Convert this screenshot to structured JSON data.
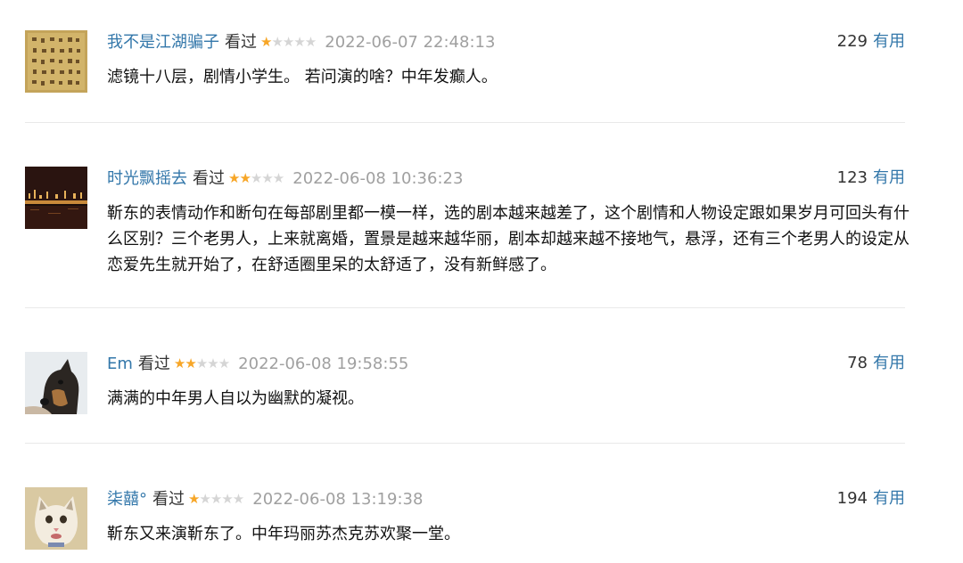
{
  "comments": [
    {
      "username": "我不是江湖骗子",
      "watched": "看过",
      "rating": 1,
      "date": "2022-06-07 22:48:13",
      "votes": "229",
      "useful": "有用",
      "text": "滤镜十八层，剧情小学生。 若问演的啥？中年发癫人。",
      "avatar_icon": "calligraphy-avatar-icon"
    },
    {
      "username": "时光飘摇去",
      "watched": "看过",
      "rating": 2,
      "date": "2022-06-08 10:36:23",
      "votes": "123",
      "useful": "有用",
      "text": "靳东的表情动作和断句在每部剧里都一模一样，选的剧本越来越差了，这个剧情和人物设定跟如果岁月可回头有什么区别？三个老男人，上来就离婚，置景是越来越华丽，剧本却越来越不接地气，悬浮，还有三个老男人的设定从恋爱先生就开始了，在舒适圈里呆的太舒适了，没有新鲜感了。",
      "avatar_icon": "night-city-avatar-icon"
    },
    {
      "username": "Em",
      "watched": "看过",
      "rating": 2,
      "date": "2022-06-08 19:58:55",
      "votes": "78",
      "useful": "有用",
      "text": "满满的中年男人自以为幽默的凝视。",
      "avatar_icon": "dog-avatar-icon"
    },
    {
      "username": "柒囍°",
      "watched": "看过",
      "rating": 1,
      "date": "2022-06-08 13:19:38",
      "votes": "194",
      "useful": "有用",
      "text": "靳东又来演靳东了。中年玛丽苏杰克苏欢聚一堂。",
      "avatar_icon": "cat-avatar-icon"
    }
  ],
  "colors": {
    "link": "#3377aa",
    "star_on": "#f7a627",
    "star_off": "#d5d5d5",
    "date": "#a0a0a0"
  }
}
